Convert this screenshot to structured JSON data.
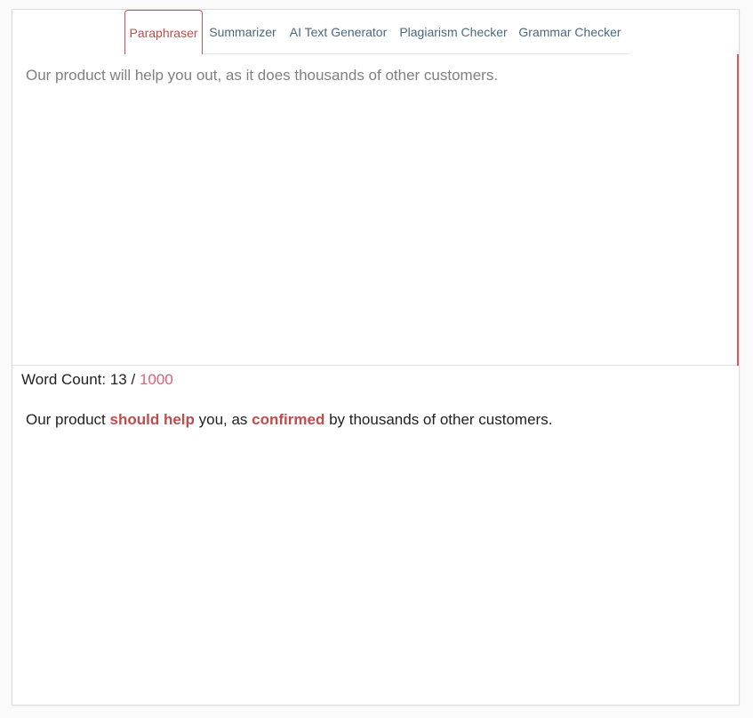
{
  "tabs": [
    {
      "label": "Paraphraser",
      "active": true
    },
    {
      "label": "Summarizer",
      "active": false
    },
    {
      "label": "AI Text Generator",
      "active": false
    },
    {
      "label": "Plagiarism Checker",
      "active": false
    },
    {
      "label": "Grammar Checker",
      "active": false
    }
  ],
  "input": {
    "text": "Our product will help you out, as it does thousands of other customers."
  },
  "word_count": {
    "label": "Word Count:",
    "current": "13",
    "separator": "/",
    "limit": "1000"
  },
  "output": {
    "part1": "Our product ",
    "highlight1": "should help",
    "part2": " you, as ",
    "highlight2": "confirmed",
    "part3": " by thousands of other customers."
  },
  "colors": {
    "accent": "#c24b4b",
    "tab_text": "#4d6780",
    "limit": "#e65c7a"
  }
}
